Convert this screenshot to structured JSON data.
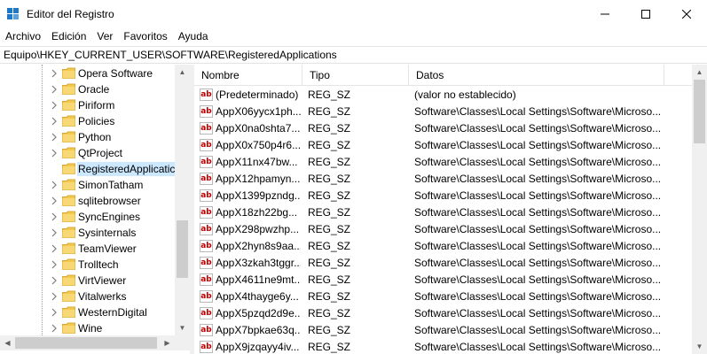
{
  "window": {
    "title": "Editor del Registro",
    "controls": {
      "minimize": "minimize-icon",
      "maximize": "maximize-icon",
      "close": "close-icon"
    }
  },
  "menu": [
    "Archivo",
    "Edición",
    "Ver",
    "Favoritos",
    "Ayuda"
  ],
  "address": "Equipo\\HKEY_CURRENT_USER\\SOFTWARE\\RegisteredApplications",
  "tree": {
    "selected": "RegisteredApplications",
    "items": [
      "Opera Software",
      "Oracle",
      "Piriform",
      "Policies",
      "Python",
      "QtProject",
      "RegisteredApplicatic",
      "SimonTatham",
      "sqlitebrowser",
      "SyncEngines",
      "Sysinternals",
      "TeamViewer",
      "Trolltech",
      "VirtViewer",
      "Vitalwerks",
      "WesternDigital",
      "Wine"
    ]
  },
  "list": {
    "columns": [
      "Nombre",
      "Tipo",
      "Datos"
    ],
    "rows": [
      {
        "name": "(Predeterminado)",
        "type": "REG_SZ",
        "data": "(valor no establecido)"
      },
      {
        "name": "AppX06yycx1ph...",
        "type": "REG_SZ",
        "data": "Software\\Classes\\Local Settings\\Software\\Microso..."
      },
      {
        "name": "AppX0na0shta7...",
        "type": "REG_SZ",
        "data": "Software\\Classes\\Local Settings\\Software\\Microso..."
      },
      {
        "name": "AppX0x750p4r6...",
        "type": "REG_SZ",
        "data": "Software\\Classes\\Local Settings\\Software\\Microso..."
      },
      {
        "name": "AppX11nx47bw...",
        "type": "REG_SZ",
        "data": "Software\\Classes\\Local Settings\\Software\\Microso..."
      },
      {
        "name": "AppX12hpamyn...",
        "type": "REG_SZ",
        "data": "Software\\Classes\\Local Settings\\Software\\Microso..."
      },
      {
        "name": "AppX1399pzndg...",
        "type": "REG_SZ",
        "data": "Software\\Classes\\Local Settings\\Software\\Microso..."
      },
      {
        "name": "AppX18zh22bg...",
        "type": "REG_SZ",
        "data": "Software\\Classes\\Local Settings\\Software\\Microso..."
      },
      {
        "name": "AppX298pwzhp...",
        "type": "REG_SZ",
        "data": "Software\\Classes\\Local Settings\\Software\\Microso..."
      },
      {
        "name": "AppX2hyn8s9aa...",
        "type": "REG_SZ",
        "data": "Software\\Classes\\Local Settings\\Software\\Microso..."
      },
      {
        "name": "AppX3zkah3tggr...",
        "type": "REG_SZ",
        "data": "Software\\Classes\\Local Settings\\Software\\Microso..."
      },
      {
        "name": "AppX4611ne9mt...",
        "type": "REG_SZ",
        "data": "Software\\Classes\\Local Settings\\Software\\Microso..."
      },
      {
        "name": "AppX4thayge6y...",
        "type": "REG_SZ",
        "data": "Software\\Classes\\Local Settings\\Software\\Microso..."
      },
      {
        "name": "AppX5pzqd2d9e...",
        "type": "REG_SZ",
        "data": "Software\\Classes\\Local Settings\\Software\\Microso..."
      },
      {
        "name": "AppX7bpkae63q...",
        "type": "REG_SZ",
        "data": "Software\\Classes\\Local Settings\\Software\\Microso..."
      },
      {
        "name": "AppX9jzqayy4iv...",
        "type": "REG_SZ",
        "data": "Software\\Classes\\Local Settings\\Software\\Microso..."
      }
    ],
    "value_icon": "string-value-icon"
  },
  "colors": {
    "selection": "#cce8ff",
    "folder": "#e8c45c",
    "icon_text": "#c00000"
  }
}
